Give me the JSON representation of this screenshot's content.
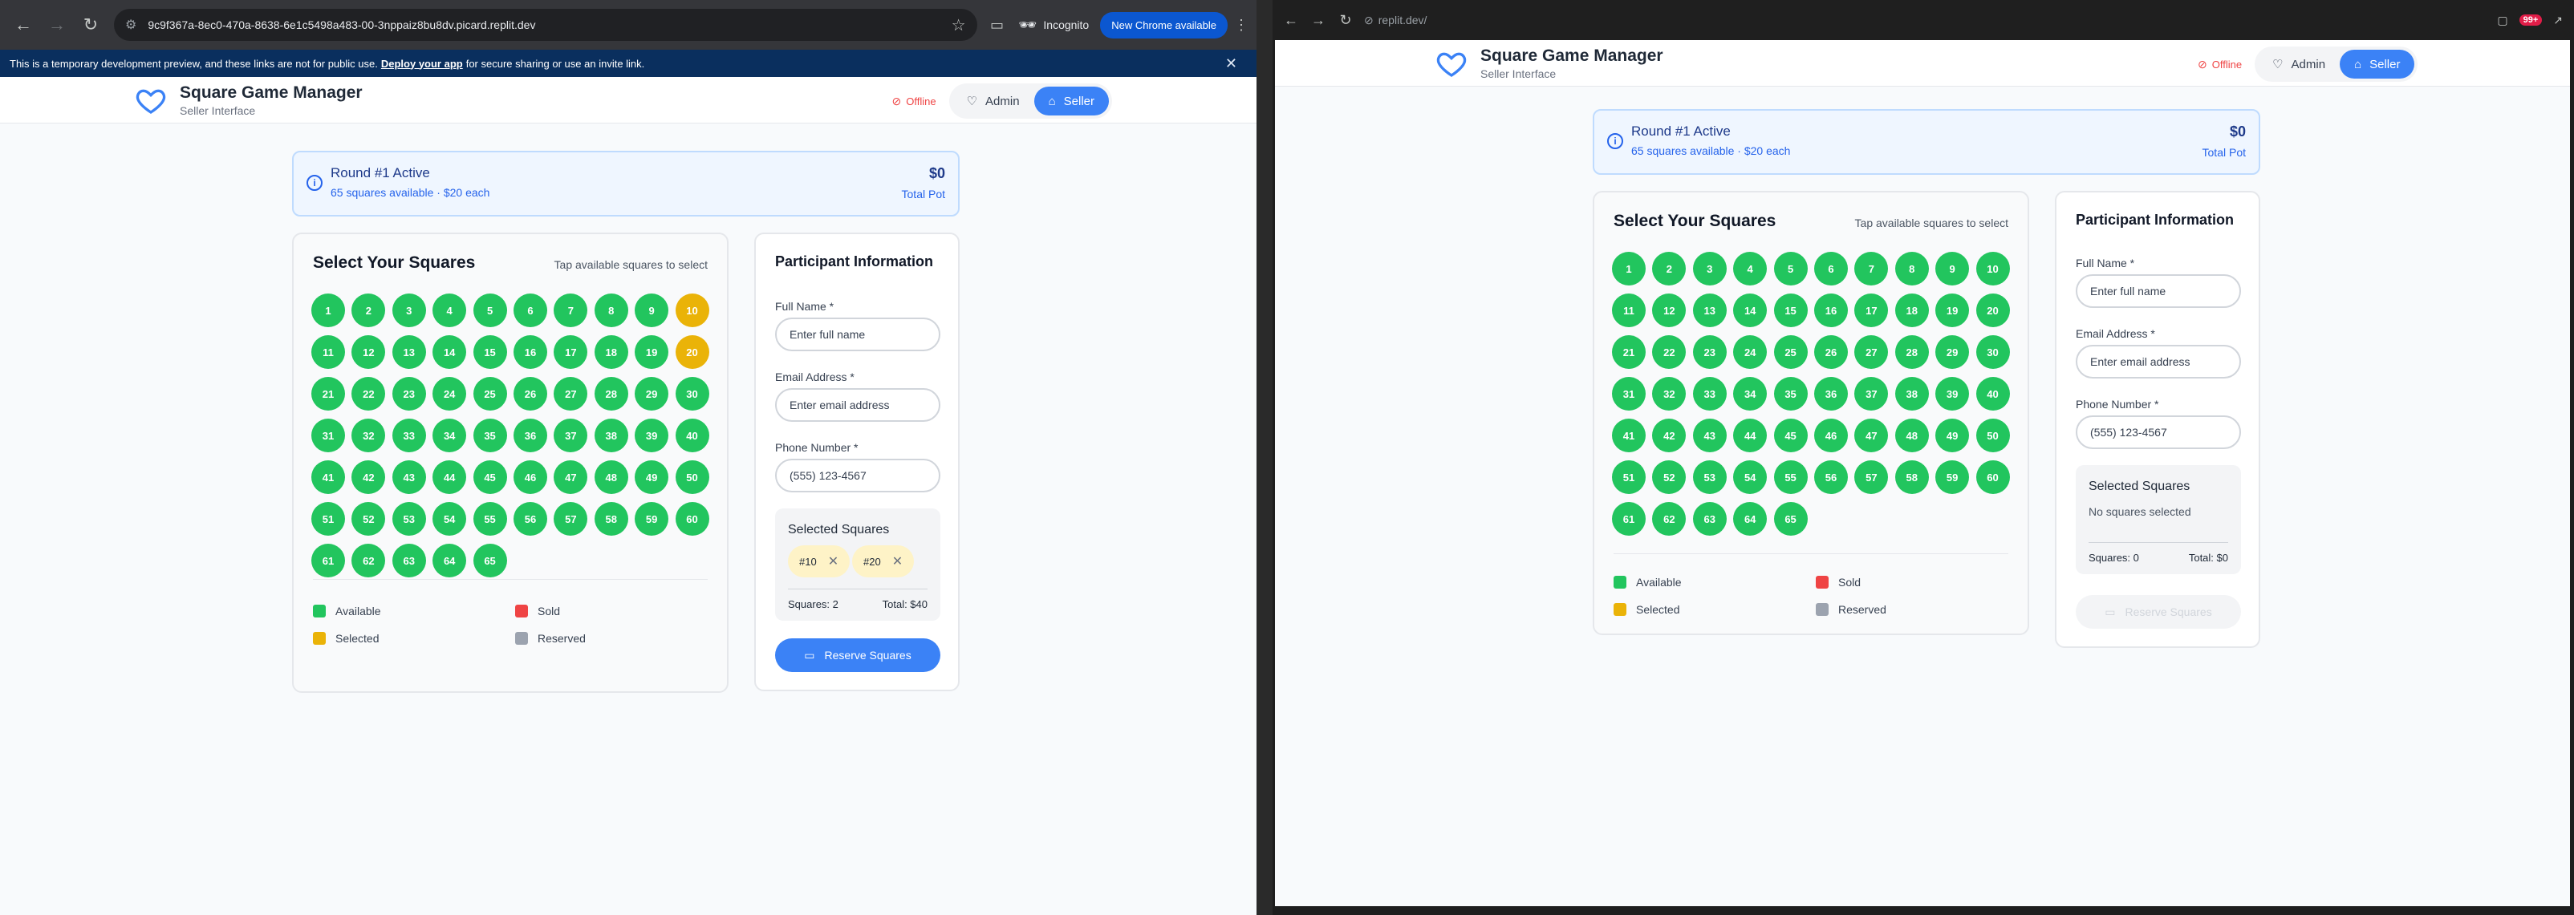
{
  "left": {
    "url": "9c9f367a-8ec0-470a-8638-6e1c5498a483-00-3nppaiz8bu8dv.picard.replit.dev",
    "incognito": "Incognito",
    "new_chrome": "New Chrome available",
    "banner": {
      "text_before": "This is a temporary development preview, and these links are not for public use.",
      "link": "Deploy your app",
      "text_after": "for secure sharing or use an invite link."
    },
    "selected_chips": [
      "#10",
      "#20"
    ],
    "squares_count": "Squares: 2",
    "total": "Total: $40",
    "selected": [
      10,
      20
    ]
  },
  "right": {
    "url": "replit.dev/",
    "notif_count": "99+",
    "no_squares": "No squares selected",
    "squares_count": "Squares: 0",
    "total": "Total: $0",
    "selected": []
  },
  "app": {
    "title": "Square Game Manager",
    "subtitle": "Seller Interface",
    "offline": "Offline",
    "admin": "Admin",
    "seller": "Seller",
    "round_title": "Round #1 Active",
    "round_info": "65 squares available · $20 each",
    "pot": "$0",
    "pot_label": "Total Pot",
    "select_title": "Select Your Squares",
    "select_hint": "Tap available squares to select",
    "total_squares": 65,
    "legend": [
      "Available",
      "Sold",
      "Selected",
      "Reserved"
    ],
    "participant_title": "Participant Information",
    "full_name_label": "Full Name *",
    "full_name_placeholder": "Enter full name",
    "email_label": "Email Address *",
    "email_placeholder": "Enter email address",
    "phone_label": "Phone Number *",
    "phone_placeholder": "(555) 123-4567",
    "selected_squares_title": "Selected Squares",
    "reserve_button": "Reserve Squares"
  },
  "colors": {
    "available": "#22c55e",
    "sold": "#ef4444",
    "selected": "#eab308",
    "reserved": "#9ca3af",
    "accent": "#3b82f6"
  }
}
